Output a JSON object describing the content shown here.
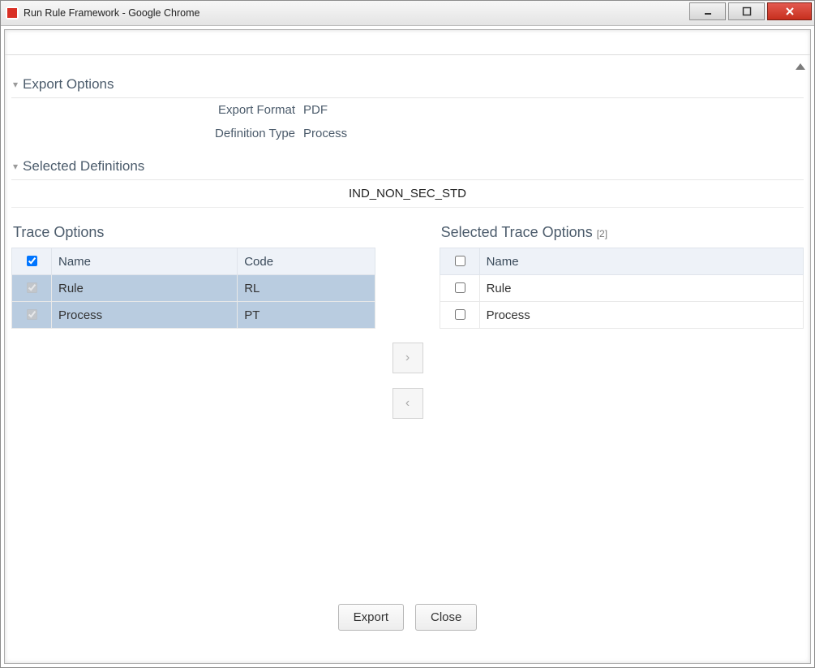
{
  "window": {
    "title": "Run Rule Framework - Google Chrome"
  },
  "sections": {
    "export_options": {
      "title": "Export Options",
      "rows": {
        "export_format": {
          "label": "Export Format",
          "value": "PDF"
        },
        "definition_type": {
          "label": "Definition Type",
          "value": "Process"
        }
      }
    },
    "selected_definitions": {
      "title": "Selected Definitions",
      "value": "IND_NON_SEC_STD"
    }
  },
  "trace_options": {
    "title": "Trace Options",
    "header_name": "Name",
    "header_code": "Code",
    "rows": [
      {
        "name": "Rule",
        "code": "RL",
        "checked": true
      },
      {
        "name": "Process",
        "code": "PT",
        "checked": true
      }
    ]
  },
  "selected_trace_options": {
    "title": "Selected Trace Options",
    "count": "[2]",
    "header_name": "Name",
    "rows": [
      {
        "name": "Rule",
        "checked": false
      },
      {
        "name": "Process",
        "checked": false
      }
    ]
  },
  "buttons": {
    "export": "Export",
    "close": "Close"
  }
}
